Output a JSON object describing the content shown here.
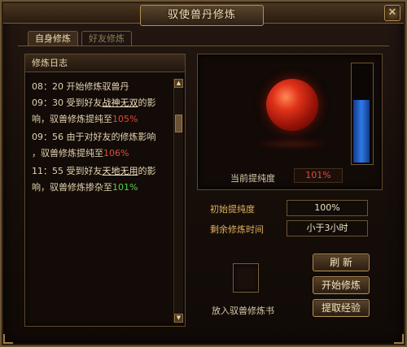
{
  "window": {
    "title": "驭使兽丹修炼",
    "close_label": "✕"
  },
  "tabs": [
    {
      "label": "自身修炼",
      "active": true
    },
    {
      "label": "好友修炼",
      "active": false
    }
  ],
  "log": {
    "title": "修炼日志",
    "lines": [
      {
        "parts": [
          "08：20  开始修炼驭兽丹"
        ]
      },
      {
        "parts": [
          "09：30  受到好友",
          "战神无双",
          "的影"
        ]
      },
      {
        "parts": [
          "响，驭兽修炼提纯至",
          "105%"
        ]
      },
      {
        "parts": [
          "09：56  由于对好友的修炼影响"
        ]
      },
      {
        "parts": [
          "，驭兽修炼提纯至",
          "106%"
        ]
      },
      {
        "parts": [
          "11：55  受到好友",
          "天地无用",
          "的影"
        ]
      },
      {
        "parts": [
          "响，驭兽修炼掺杂至",
          "101%"
        ]
      }
    ]
  },
  "orb": {
    "purity_label": "当前提纯度",
    "purity_value": "101%",
    "gauge_level_percent": 64
  },
  "fields": {
    "initial_purity_label": "初始提纯度",
    "initial_purity_value": "100%",
    "remaining_time_label": "剩余修炼时间",
    "remaining_time_value": "小于3小时"
  },
  "slot": {
    "label": "放入驭兽修炼书"
  },
  "buttons": {
    "refresh": "刷 新",
    "start": "开始修炼",
    "extract": "提取经验"
  },
  "colors": {
    "accent_gold": "#e0b15e",
    "red_value": "#e24b3a",
    "green_value": "#53d24a",
    "gauge_blue": "#2e7ae6"
  }
}
